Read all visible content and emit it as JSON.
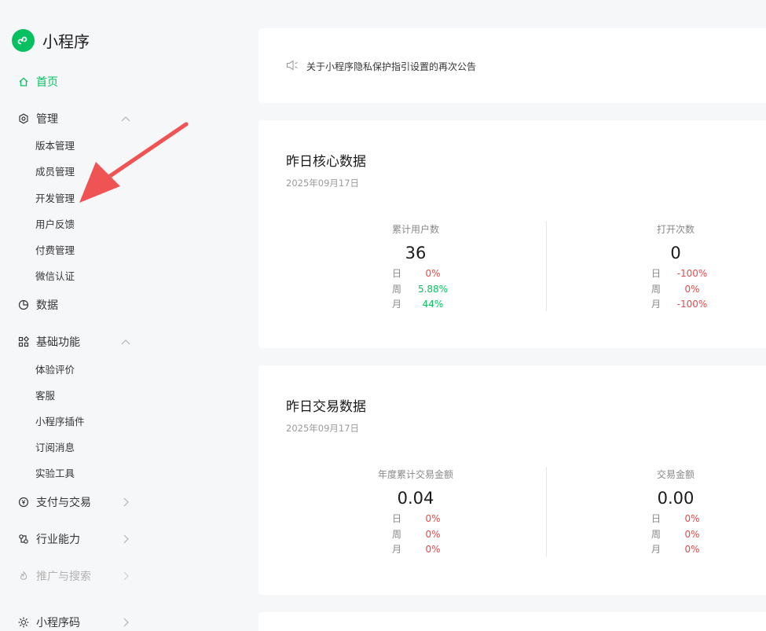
{
  "app": {
    "title": "小程序"
  },
  "sidebar": {
    "home": "首页",
    "manage": {
      "label": "管理",
      "items": [
        "版本管理",
        "成员管理",
        "开发管理",
        "用户反馈",
        "付费管理",
        "微信认证"
      ]
    },
    "data": "数据",
    "basic": {
      "label": "基础功能",
      "items": [
        "体验评价",
        "客服",
        "小程序插件",
        "订阅消息",
        "实验工具"
      ]
    },
    "payment": "支付与交易",
    "industry": "行业能力",
    "promotion": "推广与搜索",
    "qrcode": "小程序码"
  },
  "notice": {
    "text": "关于小程序隐私保护指引设置的再次公告"
  },
  "core": {
    "title": "昨日核心数据",
    "date": "2025年09月17日",
    "metrics": [
      {
        "label": "累计用户数",
        "value": "36",
        "stats": [
          {
            "k": "日",
            "v": "0%"
          },
          {
            "k": "周",
            "v": "5.88%"
          },
          {
            "k": "月",
            "v": "44%"
          }
        ]
      },
      {
        "label": "打开次数",
        "value": "0",
        "stats": [
          {
            "k": "日",
            "v": "-100%"
          },
          {
            "k": "周",
            "v": "0%"
          },
          {
            "k": "月",
            "v": "-100%"
          }
        ]
      }
    ]
  },
  "trade": {
    "title": "昨日交易数据",
    "date": "2025年09月17日",
    "metrics": [
      {
        "label": "年度累计交易金额",
        "value": "0.04",
        "stats": [
          {
            "k": "日",
            "v": "0%"
          },
          {
            "k": "周",
            "v": "0%"
          },
          {
            "k": "月",
            "v": "0%"
          }
        ]
      },
      {
        "label": "交易金额",
        "value": "0.00",
        "stats": [
          {
            "k": "日",
            "v": "0%"
          },
          {
            "k": "周",
            "v": "0%"
          },
          {
            "k": "月",
            "v": "0%"
          }
        ]
      }
    ]
  },
  "colors": {
    "accent": "#07c160",
    "negative": "#e24a4a",
    "arrow": "#f05353"
  }
}
